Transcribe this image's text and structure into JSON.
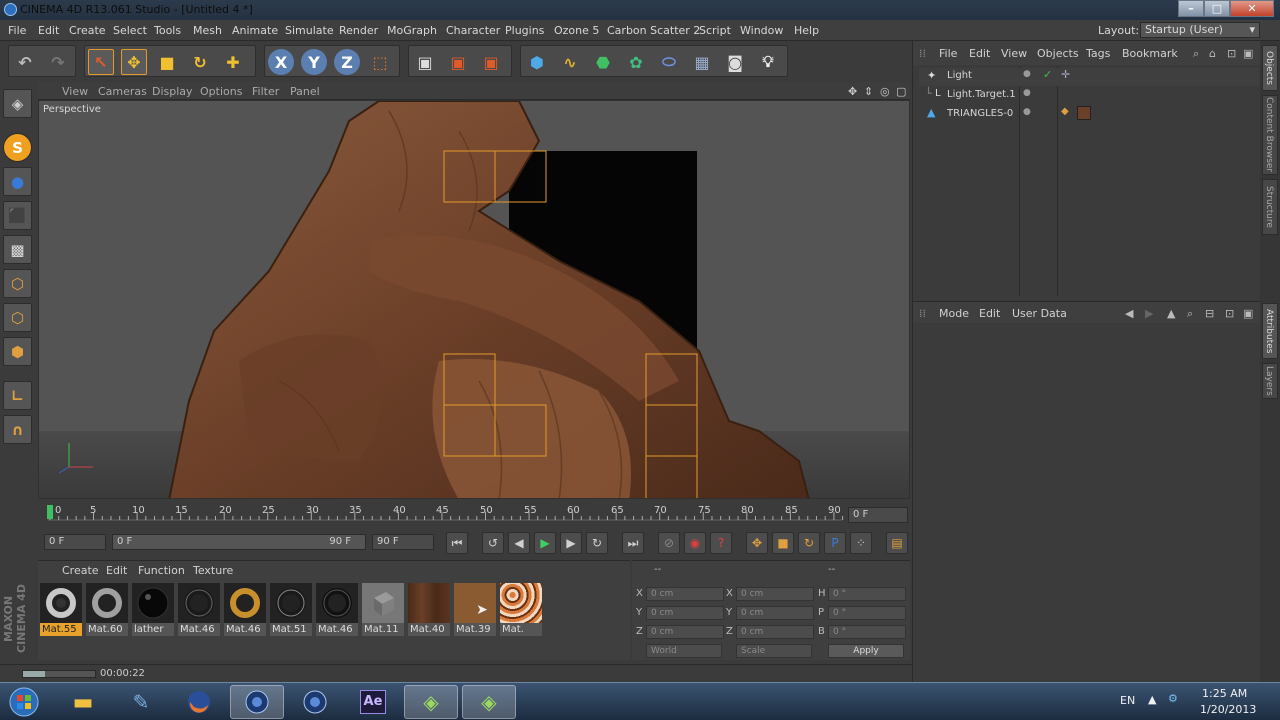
{
  "window": {
    "title": "CINEMA 4D R13.061 Studio - [Untitled 4 *]",
    "minimize": "–",
    "maximize": "□",
    "close": "✕"
  },
  "menubar": {
    "items": [
      "File",
      "Edit",
      "Create",
      "Select",
      "Tools",
      "Mesh",
      "Animate",
      "Simulate",
      "Render",
      "MoGraph",
      "Character",
      "Plugins",
      "Ozone 5",
      "Carbon Scatter 2",
      "Script",
      "Window",
      "Help"
    ],
    "layout_label": "Layout:",
    "layout_value": "Startup (User)"
  },
  "viewport": {
    "menu": [
      "View",
      "Cameras",
      "Display",
      "Options",
      "Filter",
      "Panel"
    ],
    "label": "Perspective"
  },
  "timeline": {
    "ticks": [
      "0",
      "5",
      "10",
      "15",
      "20",
      "25",
      "30",
      "35",
      "40",
      "45",
      "50",
      "55",
      "60",
      "65",
      "70",
      "75",
      "80",
      "85",
      "90"
    ],
    "current_frame": "0 F",
    "start_field": "0 F",
    "range_start": "0 F",
    "range_end": "90 F",
    "end_field": "90 F"
  },
  "materials": {
    "menu": [
      "Create",
      "Edit",
      "Function",
      "Texture"
    ],
    "items": [
      {
        "label": "Mat.55",
        "kind": "chrome-knot",
        "selected": true
      },
      {
        "label": "Mat.60",
        "kind": "silver-knot",
        "selected": false
      },
      {
        "label": "lather",
        "kind": "black-sphere",
        "selected": false
      },
      {
        "label": "Mat.46",
        "kind": "dark-knot",
        "selected": false
      },
      {
        "label": "Mat.46",
        "kind": "gold-knot",
        "selected": false
      },
      {
        "label": "Mat.51",
        "kind": "dark-knot",
        "selected": false
      },
      {
        "label": "Mat.46",
        "kind": "dark-knot",
        "selected": false
      },
      {
        "label": "Mat.11",
        "kind": "grey-cube",
        "selected": false
      },
      {
        "label": "Mat.40",
        "kind": "wood",
        "selected": false
      },
      {
        "label": "Mat.39",
        "kind": "brown",
        "selected": false
      },
      {
        "label": "Mat.",
        "kind": "leopard",
        "selected": false
      }
    ]
  },
  "coordinates": {
    "header_left": "--",
    "header_right": "--",
    "rows": [
      {
        "a": "X",
        "av": "0 cm",
        "b": "X",
        "bv": "0 cm",
        "c": "H",
        "cv": "0 °"
      },
      {
        "a": "Y",
        "av": "0 cm",
        "b": "Y",
        "bv": "0 cm",
        "c": "P",
        "cv": "0 °"
      },
      {
        "a": "Z",
        "av": "0 cm",
        "b": "Z",
        "bv": "0 cm",
        "c": "B",
        "cv": "0 °"
      }
    ],
    "world": "World",
    "scale": "Scale",
    "apply": "Apply"
  },
  "status": {
    "time": "00:00:22"
  },
  "objects": {
    "menu": [
      "File",
      "Edit",
      "View",
      "Objects",
      "Tags",
      "Bookmark"
    ],
    "rows": [
      {
        "name": "Light"
      },
      {
        "name": "Light.Target.1"
      },
      {
        "name": "TRIANGLES-0"
      }
    ]
  },
  "attributes": {
    "menu": [
      "Mode",
      "Edit",
      "User Data"
    ]
  },
  "side_tabs": [
    "Objects",
    "Content Browser",
    "Structure",
    "Attributes",
    "Layers"
  ],
  "brand": "MAXON CINEMA 4D",
  "taskbar": {
    "language": "EN",
    "time": "1:25 AM",
    "date": "1/20/2013",
    "ae_label": "Ae"
  },
  "colors": {
    "accent": "#e8a22c",
    "selection_box": "#e39a2a",
    "viewport_bg": "#525252"
  }
}
